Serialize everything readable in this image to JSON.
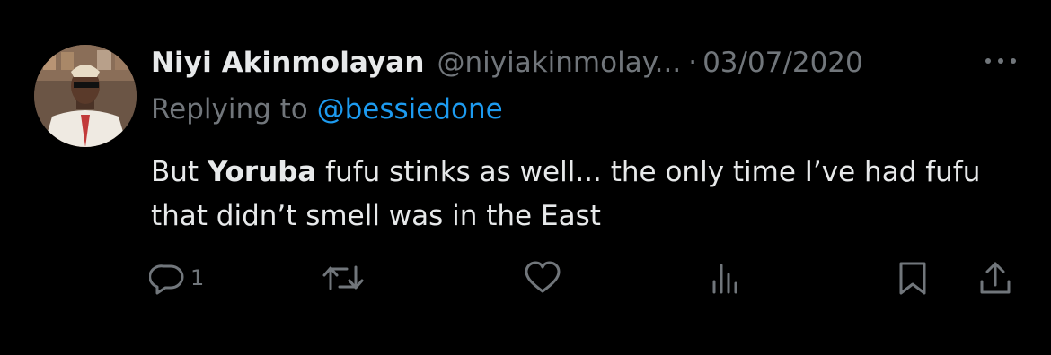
{
  "tweet": {
    "author_name": "Niyi Akinmolayan",
    "handle": "@niyiakinmolay...",
    "separator": "·",
    "date": "03/07/2020",
    "replying_prefix": "Replying to ",
    "replying_to": "@bessiedone",
    "body_part1": "But ",
    "body_bold": "Yoruba",
    "body_part2": " fufu stinks as well... the only time I’ve had fufu that didn’t smell was in the East",
    "reply_count": "1"
  },
  "icons": {
    "more": "more-horizontal-icon",
    "reply": "reply-icon",
    "retweet": "retweet-icon",
    "like": "heart-icon",
    "views": "views-icon",
    "bookmark": "bookmark-icon",
    "share": "share-icon"
  },
  "colors": {
    "background": "#000000",
    "text": "#e7e9ea",
    "muted": "#71767b",
    "link": "#1d9bf0"
  }
}
